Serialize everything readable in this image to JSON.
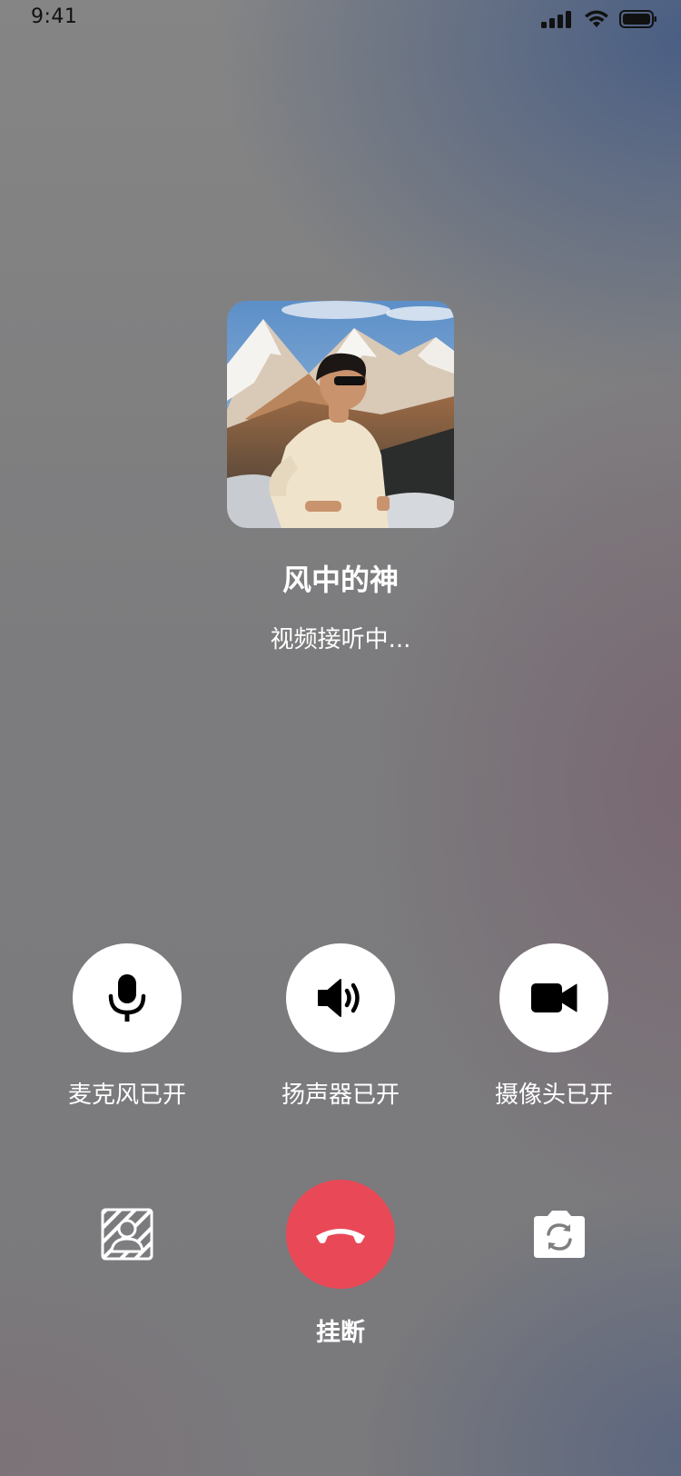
{
  "status_bar": {
    "time": "9:41",
    "icons": [
      "cellular-signal-icon",
      "wifi-icon",
      "battery-icon"
    ]
  },
  "caller": {
    "name": "风中的神",
    "status": "视频接听中..."
  },
  "controls": {
    "microphone": {
      "label": "麦克风已开",
      "icon": "microphone-icon"
    },
    "speaker": {
      "label": "扬声器已开",
      "icon": "speaker-icon"
    },
    "camera": {
      "label": "摄像头已开",
      "icon": "video-camera-icon"
    }
  },
  "bottom": {
    "hangup_label": "挂断",
    "hangup_icon": "phone-hangup-icon",
    "left_icon": "background-blur-icon",
    "right_icon": "switch-camera-icon"
  },
  "colors": {
    "hangup": "#e94856",
    "control_bg": "#ffffff",
    "text": "#ffffff"
  }
}
